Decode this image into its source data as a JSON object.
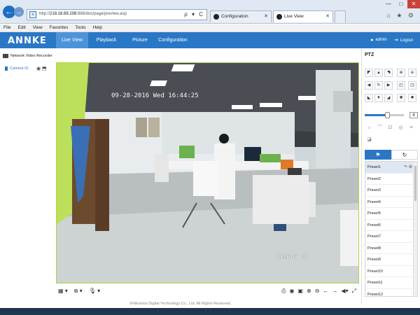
{
  "browser": {
    "url_prefix": "http://",
    "url_host": "218.18.69.208",
    "url_rest": ":888/doc/page/preview.asp",
    "address_icons": "ρ ▾ C",
    "tabs": [
      {
        "label": "Configuration",
        "close": "✕"
      },
      {
        "label": "Live View",
        "close": "✕"
      }
    ],
    "window_controls": [
      "—",
      "□",
      "✕"
    ],
    "right_icons": "⌂ ★ ⚙"
  },
  "menu": [
    "File",
    "Edit",
    "View",
    "Favorites",
    "Tools",
    "Help"
  ],
  "app": {
    "brand": "ANNKE",
    "tabs": [
      "Live View",
      "Playback",
      "Picture",
      "Configuration"
    ],
    "active_tab": "Live View",
    "user": "admin",
    "logout": "Logout"
  },
  "sidebar": {
    "device": "Network Video Recorder",
    "camera": "Camera 01",
    "camera_action_icons": "◉ ⬒"
  },
  "video": {
    "osd_timestamp": "09-28-2016 Wed 16:44:25",
    "osd_camera_name": "Camera 01"
  },
  "toolbar": {
    "left_icons": [
      "▦ ▾",
      "⧉ ▾",
      "🎙 ▾"
    ],
    "right_icons": [
      "⎙",
      "◉",
      "▣",
      "⊕",
      "⊖",
      "←",
      "→",
      "◀▾",
      "⤢"
    ]
  },
  "footer": "©Hikvision Digital Technology Co., Ltd. All Rights Reserved.",
  "ptz": {
    "title": "PTZ",
    "speed_value": "4",
    "speed_level": 0.57,
    "preset_tab_icons": [
      "⚑",
      "↻"
    ],
    "presets": [
      "Preset1",
      "Preset2",
      "Preset3",
      "Preset4",
      "Preset5",
      "Preset6",
      "Preset7",
      "Preset8",
      "Preset9",
      "Preset10",
      "Preset11",
      "Preset12"
    ],
    "selected_preset": "Preset1",
    "preset_action_icons": "↷ ⚙"
  }
}
